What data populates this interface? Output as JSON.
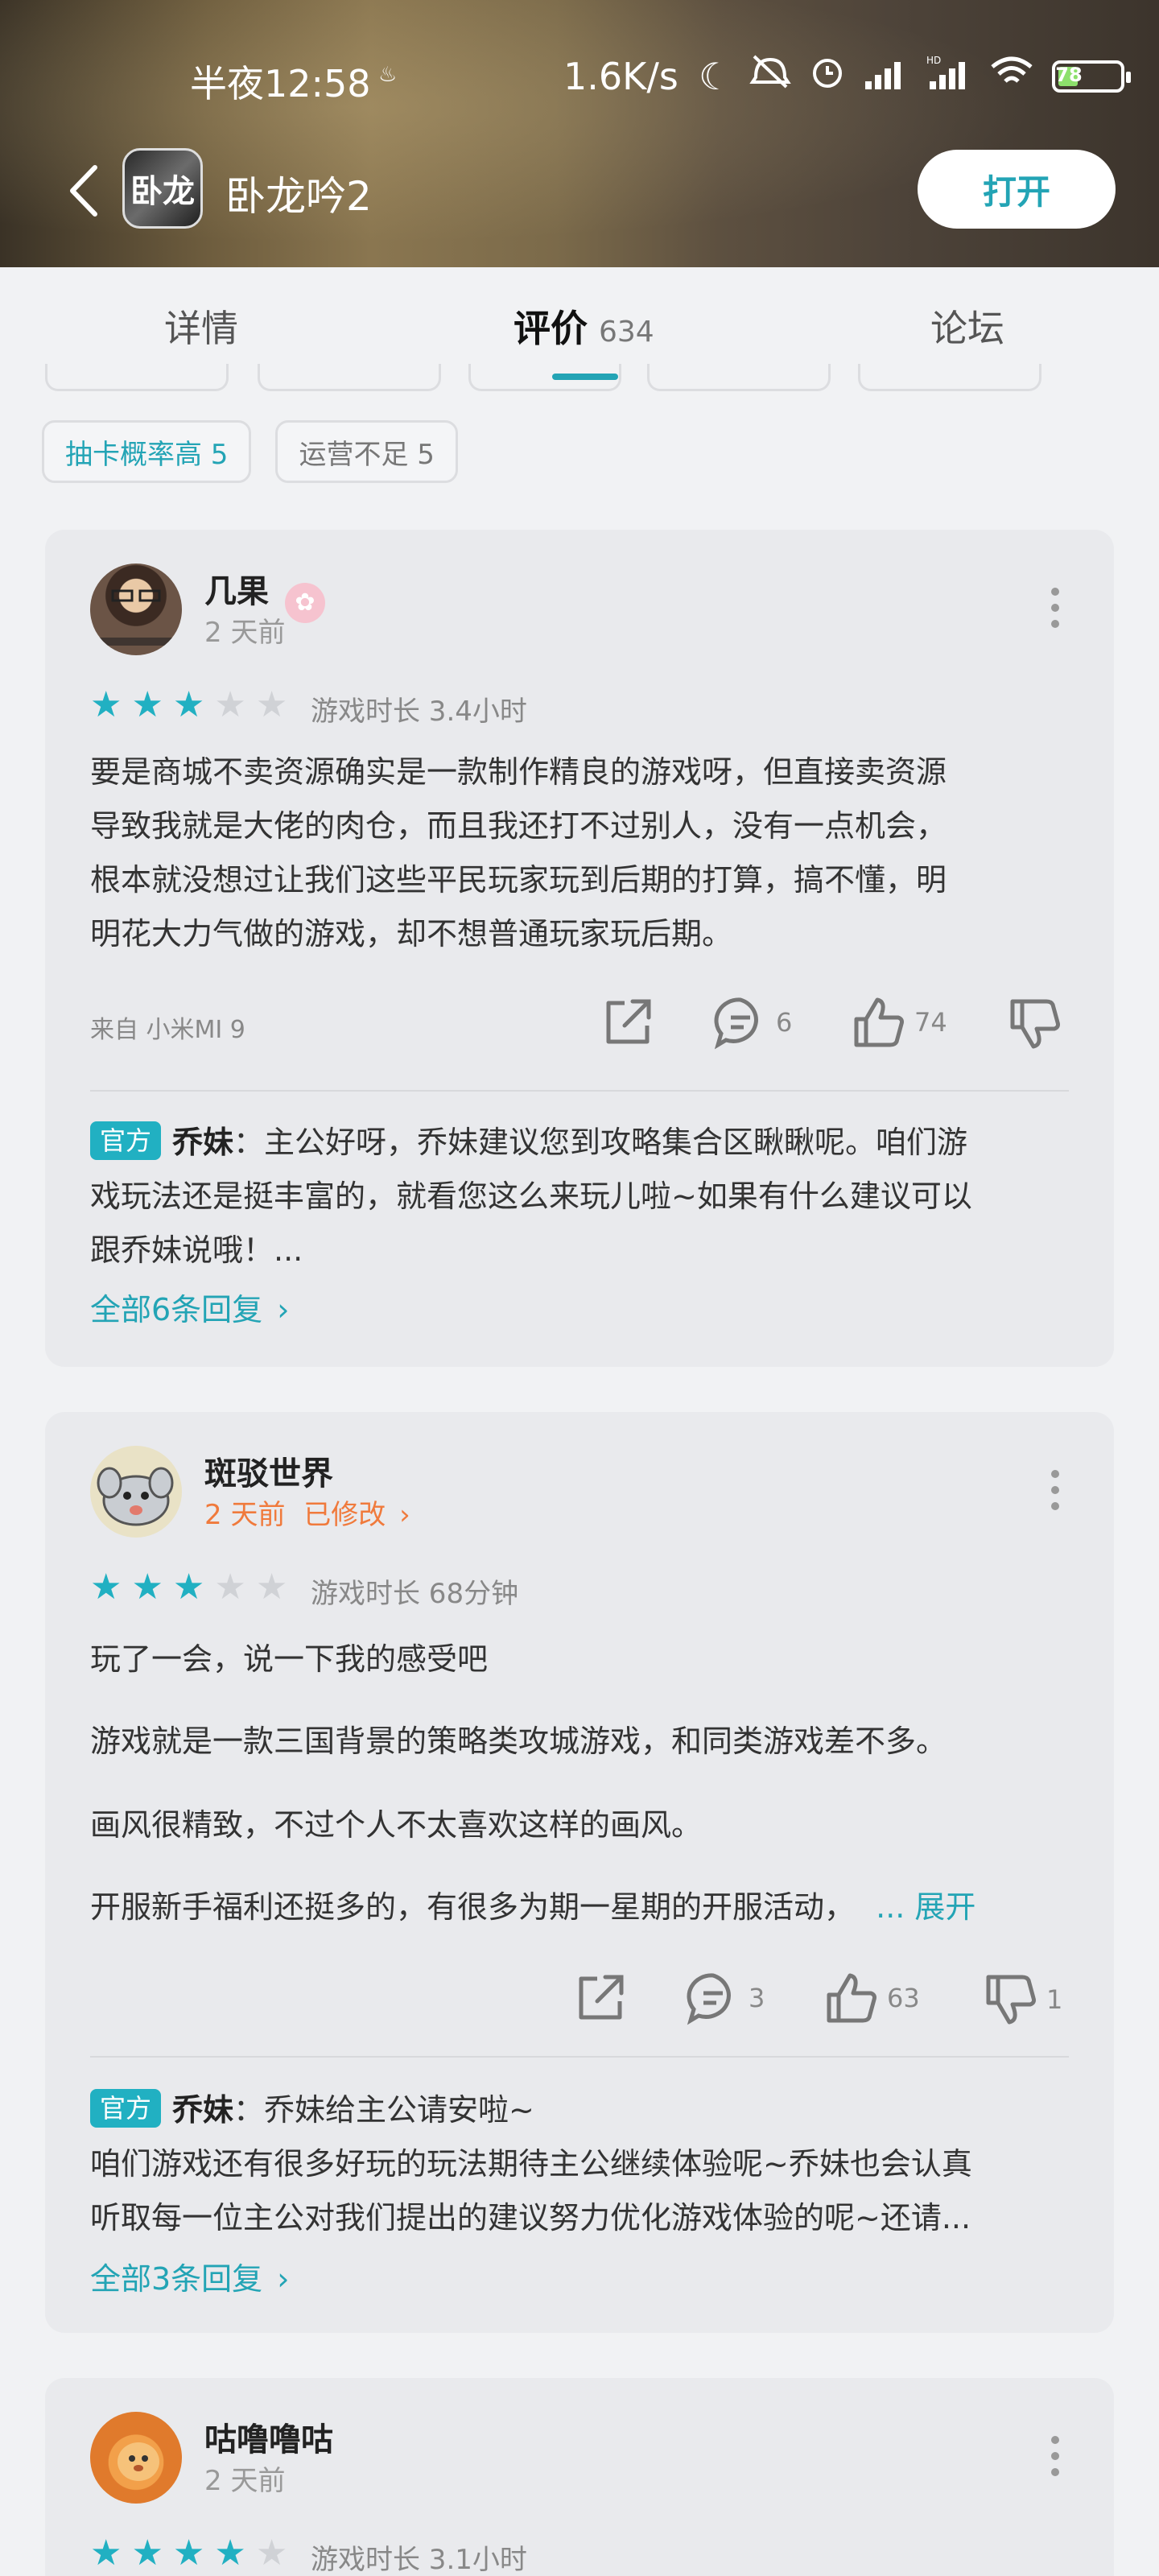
{
  "status_bar": {
    "time": "半夜12:58",
    "net_speed": "1.6K/s",
    "battery": "78"
  },
  "header": {
    "back_icon": "chevron-left-icon",
    "app_icon_text": "卧龙",
    "app_title": "卧龙吟2",
    "open_button": "打开"
  },
  "tabs": [
    {
      "label": "详情",
      "count": ""
    },
    {
      "label": "评价",
      "count": "634"
    },
    {
      "label": "论坛",
      "count": ""
    }
  ],
  "filters": [
    {
      "label": "抽卡概率高 5",
      "highlight": true
    },
    {
      "label": "运营不足 5",
      "highlight": false
    }
  ],
  "reviews": [
    {
      "user": "几果",
      "time": "2 天前",
      "rating": 3,
      "playtime": "游戏时长 3.4小时",
      "text_lines": [
        "要是商城不卖资源确实是一款制作精良的游戏呀，但直接卖资源",
        "导致我就是大佬的肉仓，而且我还打不过别人，没有一点机会，",
        "根本就没想过让我们这些平民玩家玩到后期的打算，搞不懂，明",
        "明花大力气做的游戏，却不想普通玩家玩后期。"
      ],
      "device": "来自 小米MI 9",
      "comments": "6",
      "likes": "74",
      "dislikes": "",
      "reply": {
        "tag": "官方",
        "name": "乔妹",
        "lines": [
          "：主公好呀，乔妹建议您到攻略集合区瞅瞅呢。咱们游",
          "戏玩法还是挺丰富的，就看您这么来玩儿啦~如果有什么建议可以",
          "跟乔妹说哦！..."
        ],
        "all_replies": "全部6条回复"
      }
    },
    {
      "user": "斑驳世界",
      "time": "2 天前",
      "edited": "已修改",
      "rating": 3,
      "playtime": "游戏时长 68分钟",
      "paragraphs": [
        "玩了一会，说一下我的感受吧",
        "游戏就是一款三国背景的策略类攻城游戏，和同类游戏差不多。",
        "画风很精致，不过个人不太喜欢这样的画风。",
        "开服新手福利还挺多的，有很多为期一星期的开服活动，"
      ],
      "expand": "... 展开",
      "comments": "3",
      "likes": "63",
      "dislikes": "1",
      "reply": {
        "tag": "官方",
        "name": "乔妹",
        "lines": [
          "：乔妹给主公请安啦~",
          "咱们游戏还有很多好玩的玩法期待主公继续体验呢~乔妹也会认真",
          "听取每一位主公对我们提出的建议努力优化游戏体验的呢~还请..."
        ],
        "all_replies": "全部3条回复"
      }
    },
    {
      "user": "咕噜噜咕",
      "time": "2 天前",
      "rating": 4,
      "playtime": "游戏时长 3.1小时"
    }
  ],
  "colors": {
    "accent": "#23a4b5",
    "star_on": "#21b0c2",
    "star_off": "#d0d2d6",
    "edited": "#f07a3c"
  }
}
